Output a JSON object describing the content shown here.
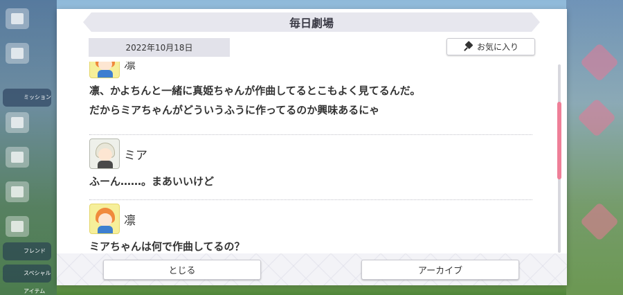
{
  "dialog": {
    "title": "毎日劇場",
    "date": "2022年10月18日",
    "favorite_label": "お気に入り",
    "close_label": "とじる",
    "archive_label": "アーカイブ"
  },
  "entries": [
    {
      "speaker": "凛",
      "lines": [
        "凛、かよちんと一緒に真姫ちゃんが作曲してるとこもよく見てるんだ。",
        "だからミアちゃんがどういうふうに作ってるのか興味あるにゃ"
      ]
    },
    {
      "speaker": "ミア",
      "lines": [
        "ふーん……。まあいいけど"
      ]
    },
    {
      "speaker": "凛",
      "lines": [
        "ミアちゃんは何で作曲してるの？"
      ]
    }
  ],
  "background": {
    "side_tags": [
      "ミッション",
      "フレンド",
      "スペシャルアイテム"
    ]
  },
  "colors": {
    "accent": "#ef7f98",
    "title_bar": "#e7e7ee"
  }
}
